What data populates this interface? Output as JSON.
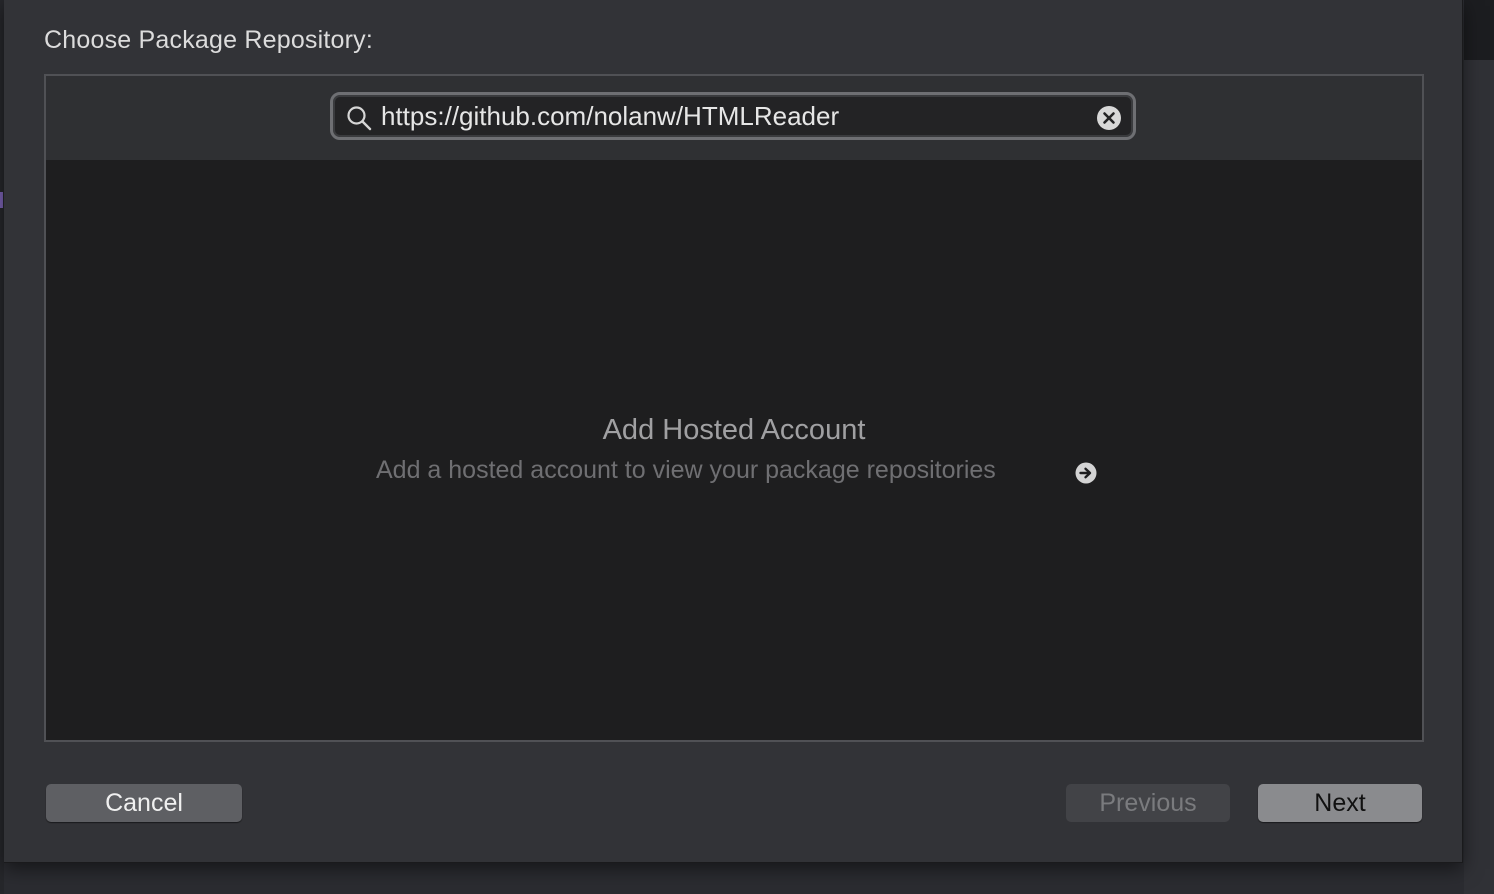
{
  "dialog": {
    "title": "Choose Package Repository:"
  },
  "search": {
    "value": "https://github.com/nolanw/HTMLReader",
    "icon": "search-icon",
    "clear_icon": "clear-icon"
  },
  "empty_state": {
    "title": "Add Hosted Account",
    "subtitle": "Add a hosted account to view your package repositories",
    "icon": "arrow-right-circle-icon"
  },
  "buttons": {
    "cancel": "Cancel",
    "previous": "Previous",
    "next": "Next"
  },
  "colors": {
    "background": "#323337",
    "panel": "#1e1e1f",
    "header": "#2f3033",
    "accent_mark": "#7a63b3"
  }
}
